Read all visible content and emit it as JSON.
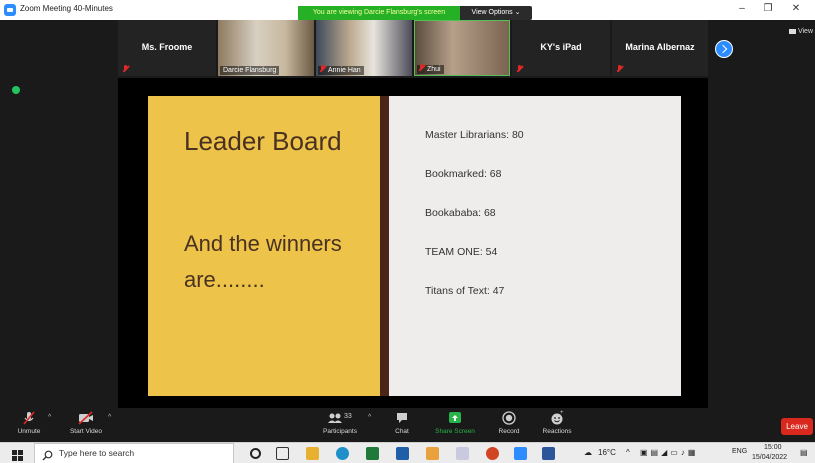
{
  "window": {
    "title": "Zoom Meeting 40-Minutes",
    "banner": "You are viewing Darcie Flansburg's screen",
    "view_options": "View Options ⌄",
    "minimize": "–",
    "restore": "❐",
    "close": "✕"
  },
  "gallery": {
    "tiles": [
      {
        "name": "Ms. Froome",
        "type": "name",
        "muted": true
      },
      {
        "name": "Darcie Flansburg",
        "type": "video",
        "muted": false
      },
      {
        "name": "Annie Han",
        "type": "video",
        "muted": true
      },
      {
        "name": "Zhui",
        "type": "video",
        "muted": true
      },
      {
        "name": "KY's iPad",
        "type": "name",
        "muted": true
      },
      {
        "name": "Marina Albernaz",
        "type": "name",
        "muted": true
      }
    ],
    "view_label": "View"
  },
  "slide": {
    "heading": "Leader Board",
    "subheading": "And the winners are........",
    "scores": [
      "Master Librarians: 80",
      "Bookmarked: 68",
      "Bookababa: 68",
      "TEAM ONE: 54",
      "Titans of Text: 47"
    ]
  },
  "toolbar": {
    "unmute": "Unmute",
    "start_video": "Start Video",
    "participants": "Participants",
    "participants_count": "33",
    "chat": "Chat",
    "share_screen": "Share Screen",
    "record": "Record",
    "reactions": "Reactions",
    "leave": "Leave"
  },
  "taskbar": {
    "search_placeholder": "Type here to search",
    "temperature": "16°C",
    "language": "ENG",
    "time": "15:00",
    "date": "15/04/2022"
  },
  "colors": {
    "zoom_blue": "#2d8cff",
    "banner_green": "#26b026",
    "slide_yellow": "#eec34a",
    "leave_red": "#d9281d"
  }
}
